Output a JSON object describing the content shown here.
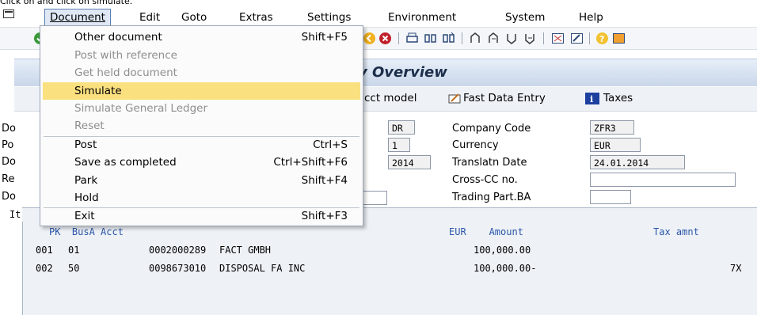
{
  "instruction": "Click on      and click on simulate.",
  "menubar": {
    "items": [
      "Document",
      "Edit",
      "Goto",
      "Extras",
      "Settings",
      "Environment",
      "System",
      "Help"
    ]
  },
  "titlebar": {
    "title": "y Overview"
  },
  "app_toolbar": {
    "acct_model": "cct model",
    "fast_data_entry": "Fast Data Entry",
    "taxes": "Taxes"
  },
  "header_fields": {
    "left_labels": [
      "Do",
      "Po",
      "Do",
      "Re",
      "Do"
    ],
    "doc_type": "DR",
    "period": "1",
    "year": "2014",
    "company_code_label": "Company Code",
    "company_code": "ZFR3",
    "currency_label": "Currency",
    "currency": "EUR",
    "translatn_date_label": "Translatn Date",
    "translatn_date": "24.01.2014",
    "cross_cc_label": "Cross-CC no.",
    "cross_cc": "",
    "trading_part_label": "Trading Part.BA",
    "trading_part": ""
  },
  "items": {
    "header_stub": "It",
    "columns_left": "PK  BusA Acct",
    "columns_right": "EUR    Amount",
    "tax_col": "Tax amnt",
    "rows": [
      {
        "no": "001",
        "pk": "01",
        "acct": "0002000289",
        "name": "FACT GMBH",
        "amount": "100,000.00",
        "tax": ""
      },
      {
        "no": "002",
        "pk": "50",
        "acct": "0098673010",
        "name": "DISPOSAL FA INC",
        "amount": "100,000.00-",
        "tax": "7X"
      }
    ]
  },
  "dropdown": {
    "items": [
      {
        "label": "Other document",
        "shortcut": "Shift+F5",
        "state": "enabled"
      },
      {
        "label": "Post with reference",
        "shortcut": "",
        "state": "disabled"
      },
      {
        "label": "Get held document",
        "shortcut": "",
        "state": "disabled"
      },
      {
        "label": "Simulate",
        "shortcut": "",
        "state": "highlighted"
      },
      {
        "label": "Simulate General Ledger",
        "shortcut": "",
        "state": "disabled"
      },
      {
        "label": "Reset",
        "shortcut": "",
        "state": "disabled"
      },
      {
        "label": "Post",
        "shortcut": "Ctrl+S",
        "state": "enabled"
      },
      {
        "label": "Save as completed",
        "shortcut": "Ctrl+Shift+F6",
        "state": "enabled"
      },
      {
        "label": "Park",
        "shortcut": "Shift+F4",
        "state": "enabled"
      },
      {
        "label": "Hold",
        "shortcut": "",
        "state": "enabled"
      },
      {
        "label": "Exit",
        "shortcut": "Shift+F3",
        "state": "enabled"
      }
    ]
  },
  "colors": {
    "highlight": "#fbe07f",
    "title_text": "#1c2d4a",
    "column_header": "#2b55a8"
  }
}
